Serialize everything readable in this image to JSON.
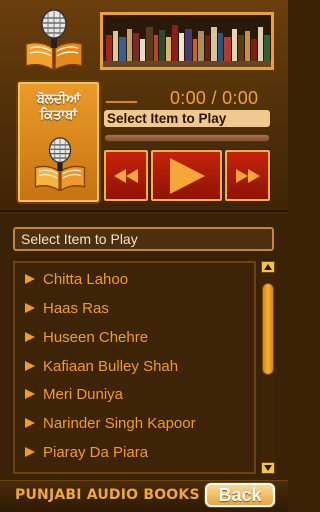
{
  "header": {
    "logo_icon": "microphone-book-icon",
    "bookshelf_image": "bookshelf-image"
  },
  "brand": {
    "title_line1": "ਬੋਲਦੀਆਂ",
    "title_line2": "ਕਿਤਾਬਾਂ"
  },
  "player": {
    "time": "0:00 / 0:00",
    "now_playing": "Select Item to Play",
    "progress_fraction": 0,
    "controls": {
      "rewind_icon": "rewind-icon",
      "play_icon": "play-icon",
      "forward_icon": "fast-forward-icon"
    }
  },
  "list": {
    "header": "Select Item to Play",
    "items": [
      "Chitta Lahoo",
      "Haas Ras",
      "Huseen Chehre",
      "Kafiaan Bulley Shah",
      "Meri Duniya",
      "Narinder Singh Kapoor",
      "Piaray Da Piara"
    ]
  },
  "footer": {
    "title": "PUNJABI AUDIO BOOKS",
    "back_label": "Back"
  },
  "colors": {
    "accent_orange": "#f39a28",
    "control_red": "#b81d09",
    "panel_brown": "#47290a"
  }
}
